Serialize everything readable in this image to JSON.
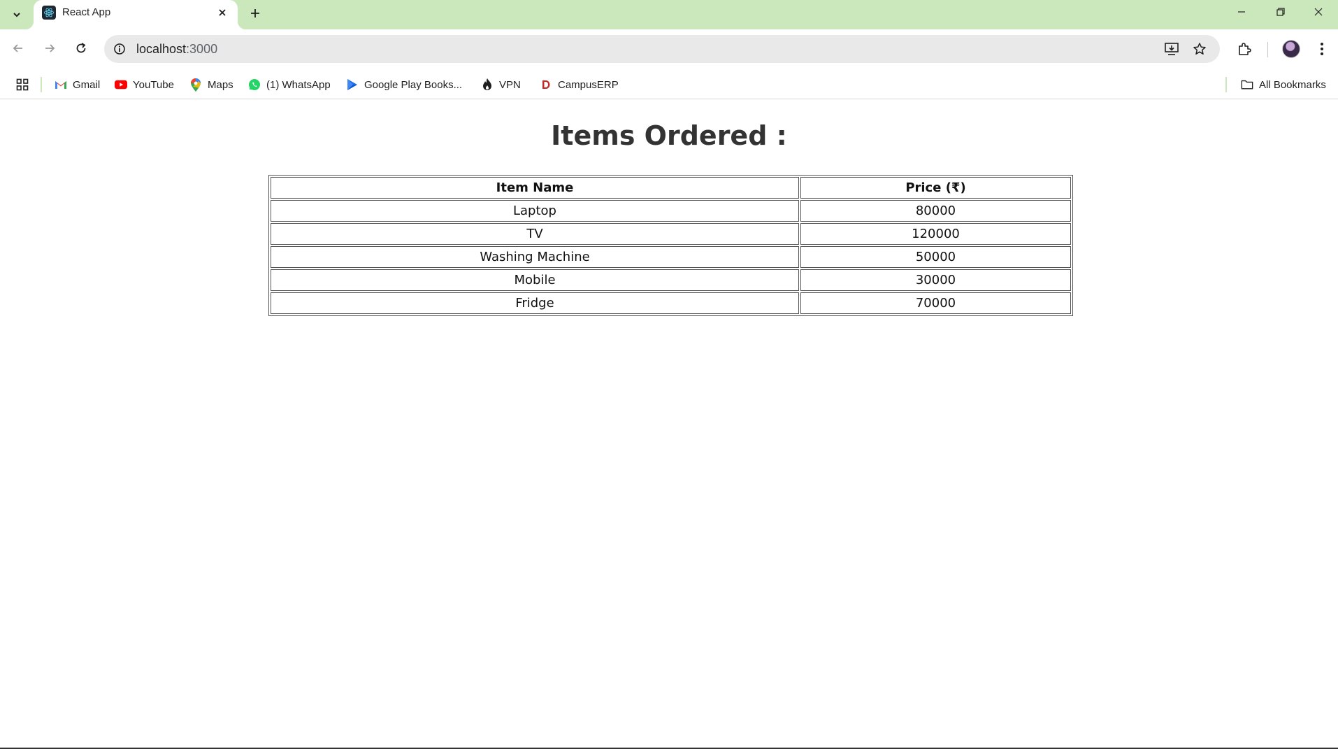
{
  "browser": {
    "tab": {
      "title": "React App"
    },
    "address": {
      "host": "localhost",
      "path": ":3000"
    },
    "bookmarks": [
      {
        "label": "Gmail",
        "icon": "gmail-icon"
      },
      {
        "label": "YouTube",
        "icon": "youtube-icon"
      },
      {
        "label": "Maps",
        "icon": "maps-icon"
      },
      {
        "label": "(1) WhatsApp",
        "icon": "whatsapp-icon"
      },
      {
        "label": "Google Play Books...",
        "icon": "play-books-icon"
      },
      {
        "label": "VPN",
        "icon": "vpn-icon"
      },
      {
        "label": "CampusERP",
        "icon": "campuserp-icon"
      }
    ],
    "all_bookmarks_label": "All Bookmarks",
    "colors": {
      "tab_strip": "#cbe8bd",
      "omnibox": "#e9e9e9"
    }
  },
  "page": {
    "title": "Items Ordered :",
    "table": {
      "headers": [
        "Item Name",
        "Price (₹)"
      ],
      "rows": [
        {
          "name": "Laptop",
          "price": "80000"
        },
        {
          "name": "TV",
          "price": "120000"
        },
        {
          "name": "Washing Machine",
          "price": "50000"
        },
        {
          "name": "Mobile",
          "price": "30000"
        },
        {
          "name": "Fridge",
          "price": "70000"
        }
      ]
    }
  }
}
